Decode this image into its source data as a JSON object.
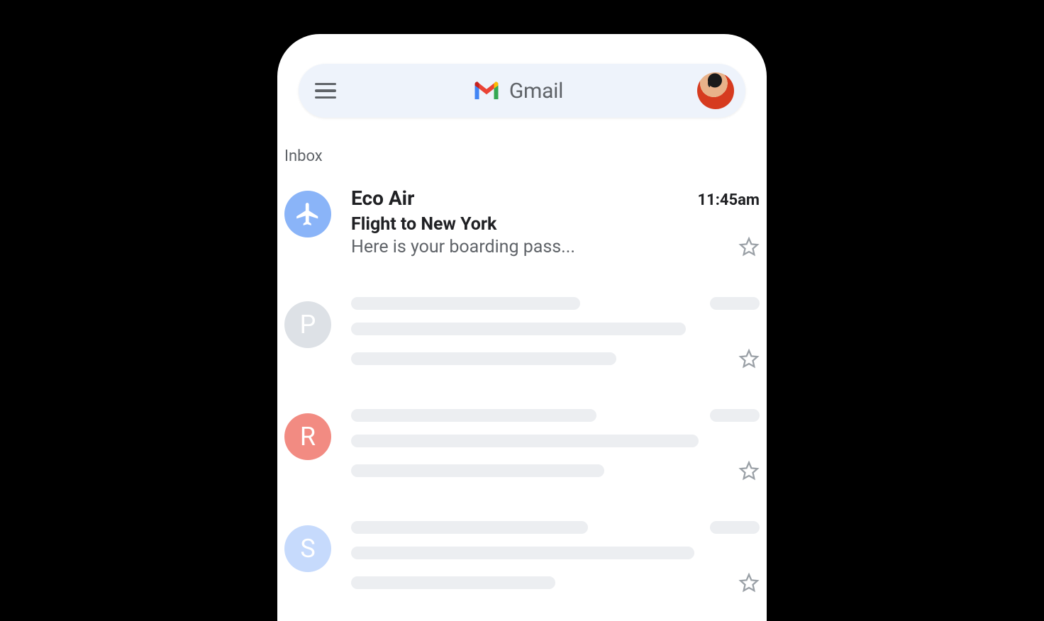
{
  "colors": {
    "searchbar_bg": "#eef3fb",
    "text_secondary": "#5f6368",
    "text_primary": "#202124",
    "placeholder": "#eceef1",
    "avatar_blue": "#8ab4f8",
    "avatar_grey": "#dde1e6",
    "avatar_red": "#f28b82",
    "avatar_lightblue": "#c6dafc"
  },
  "header": {
    "app_name": "Gmail"
  },
  "section_label": "Inbox",
  "emails": [
    {
      "sender": "Eco Air",
      "time": "11:45am",
      "subject": "Flight to New York",
      "snippet": "Here is your boarding pass...",
      "avatar_icon": "airplane-icon",
      "avatar_color": "avatar_blue",
      "starred": false,
      "unread": true
    }
  ],
  "placeholders": [
    {
      "letter": "P",
      "avatar_color": "avatar_grey"
    },
    {
      "letter": "R",
      "avatar_color": "avatar_red"
    },
    {
      "letter": "S",
      "avatar_color": "avatar_lightblue"
    }
  ]
}
